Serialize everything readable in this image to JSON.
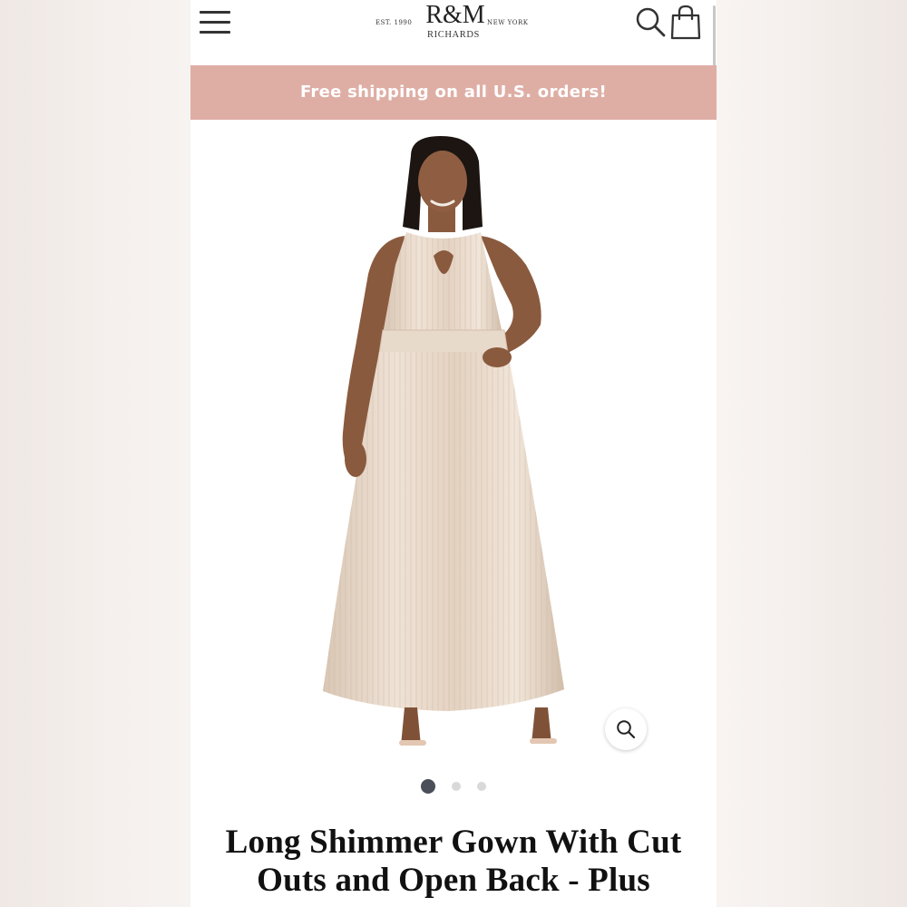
{
  "header": {
    "logo_mark": "R&M",
    "logo_subtitle": "RICHARDS",
    "logo_established": "EST. 1990",
    "logo_location": "NEW YORK"
  },
  "promo": {
    "text": "Free shipping on all U.S. orders!"
  },
  "icons": [
    "menu-icon",
    "search-icon",
    "shopping-bag-icon",
    "zoom-icon"
  ],
  "colors": {
    "promo_bg": "#deaea5",
    "active_dot": "#4a4f59",
    "inactive_dot": "#d9d9d9"
  },
  "carousel": {
    "total_slides": 3,
    "active_index": 0
  },
  "product": {
    "title_line1": "Long Shimmer Gown With Cut",
    "title_line2": "Outs and Open Back - Plus"
  }
}
